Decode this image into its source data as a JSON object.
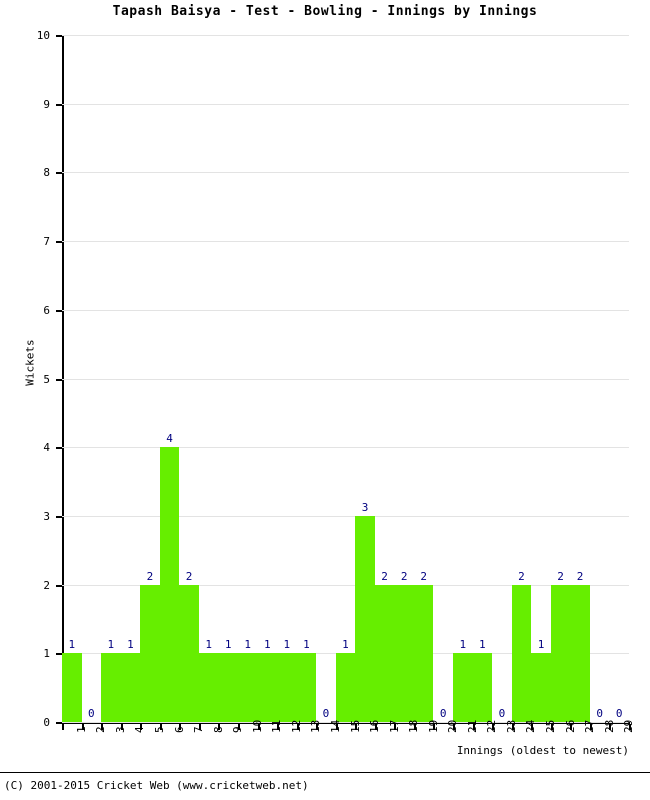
{
  "chart_data": {
    "type": "bar",
    "title": "Tapash Baisya - Test - Bowling - Innings by Innings",
    "xlabel": "Innings (oldest to newest)",
    "ylabel": "Wickets",
    "ylim": [
      0,
      10
    ],
    "ytick_labels": [
      "0",
      "1",
      "2",
      "3",
      "4",
      "5",
      "6",
      "7",
      "8",
      "9",
      "10"
    ],
    "grid": true,
    "legend": "none",
    "bar_color": "#66ee00",
    "value_label_color": "#000080",
    "categories": [
      "1",
      "2",
      "3",
      "4",
      "5",
      "6",
      "7",
      "8",
      "9",
      "10",
      "11",
      "12",
      "13",
      "14",
      "15",
      "16",
      "17",
      "18",
      "19",
      "20",
      "21",
      "22",
      "23",
      "24",
      "25",
      "26",
      "27",
      "28",
      "29"
    ],
    "values": [
      1,
      0,
      1,
      1,
      2,
      4,
      2,
      1,
      1,
      1,
      1,
      1,
      1,
      0,
      1,
      3,
      2,
      2,
      2,
      0,
      1,
      1,
      0,
      2,
      1,
      2,
      2,
      0,
      0
    ],
    "data_labels": [
      "1",
      "0",
      "1",
      "1",
      "2",
      "4",
      "2",
      "1",
      "1",
      "1",
      "1",
      "1",
      "1",
      "0",
      "1",
      "3",
      "2",
      "2",
      "2",
      "0",
      "1",
      "1",
      "0",
      "2",
      "1",
      "2",
      "2",
      "0",
      "0"
    ]
  },
  "footer": {
    "copyright": "(C) 2001-2015 Cricket Web (www.cricketweb.net)"
  }
}
